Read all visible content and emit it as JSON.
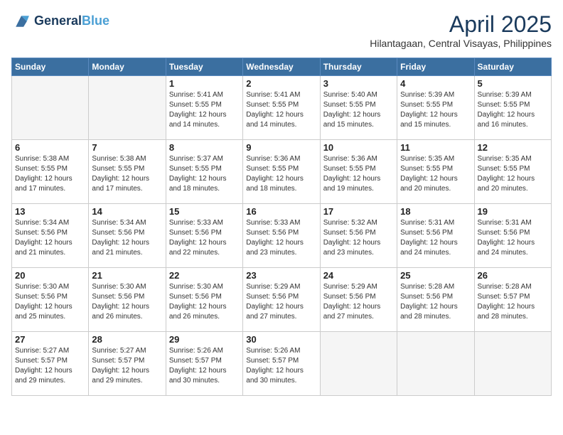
{
  "header": {
    "logo_line1": "General",
    "logo_line2": "Blue",
    "month": "April 2025",
    "location": "Hilantagaan, Central Visayas, Philippines"
  },
  "weekdays": [
    "Sunday",
    "Monday",
    "Tuesday",
    "Wednesday",
    "Thursday",
    "Friday",
    "Saturday"
  ],
  "weeks": [
    [
      {
        "day": "",
        "info": ""
      },
      {
        "day": "",
        "info": ""
      },
      {
        "day": "1",
        "info": "Sunrise: 5:41 AM\nSunset: 5:55 PM\nDaylight: 12 hours and 14 minutes."
      },
      {
        "day": "2",
        "info": "Sunrise: 5:41 AM\nSunset: 5:55 PM\nDaylight: 12 hours and 14 minutes."
      },
      {
        "day": "3",
        "info": "Sunrise: 5:40 AM\nSunset: 5:55 PM\nDaylight: 12 hours and 15 minutes."
      },
      {
        "day": "4",
        "info": "Sunrise: 5:39 AM\nSunset: 5:55 PM\nDaylight: 12 hours and 15 minutes."
      },
      {
        "day": "5",
        "info": "Sunrise: 5:39 AM\nSunset: 5:55 PM\nDaylight: 12 hours and 16 minutes."
      }
    ],
    [
      {
        "day": "6",
        "info": "Sunrise: 5:38 AM\nSunset: 5:55 PM\nDaylight: 12 hours and 17 minutes."
      },
      {
        "day": "7",
        "info": "Sunrise: 5:38 AM\nSunset: 5:55 PM\nDaylight: 12 hours and 17 minutes."
      },
      {
        "day": "8",
        "info": "Sunrise: 5:37 AM\nSunset: 5:55 PM\nDaylight: 12 hours and 18 minutes."
      },
      {
        "day": "9",
        "info": "Sunrise: 5:36 AM\nSunset: 5:55 PM\nDaylight: 12 hours and 18 minutes."
      },
      {
        "day": "10",
        "info": "Sunrise: 5:36 AM\nSunset: 5:55 PM\nDaylight: 12 hours and 19 minutes."
      },
      {
        "day": "11",
        "info": "Sunrise: 5:35 AM\nSunset: 5:55 PM\nDaylight: 12 hours and 20 minutes."
      },
      {
        "day": "12",
        "info": "Sunrise: 5:35 AM\nSunset: 5:55 PM\nDaylight: 12 hours and 20 minutes."
      }
    ],
    [
      {
        "day": "13",
        "info": "Sunrise: 5:34 AM\nSunset: 5:56 PM\nDaylight: 12 hours and 21 minutes."
      },
      {
        "day": "14",
        "info": "Sunrise: 5:34 AM\nSunset: 5:56 PM\nDaylight: 12 hours and 21 minutes."
      },
      {
        "day": "15",
        "info": "Sunrise: 5:33 AM\nSunset: 5:56 PM\nDaylight: 12 hours and 22 minutes."
      },
      {
        "day": "16",
        "info": "Sunrise: 5:33 AM\nSunset: 5:56 PM\nDaylight: 12 hours and 23 minutes."
      },
      {
        "day": "17",
        "info": "Sunrise: 5:32 AM\nSunset: 5:56 PM\nDaylight: 12 hours and 23 minutes."
      },
      {
        "day": "18",
        "info": "Sunrise: 5:31 AM\nSunset: 5:56 PM\nDaylight: 12 hours and 24 minutes."
      },
      {
        "day": "19",
        "info": "Sunrise: 5:31 AM\nSunset: 5:56 PM\nDaylight: 12 hours and 24 minutes."
      }
    ],
    [
      {
        "day": "20",
        "info": "Sunrise: 5:30 AM\nSunset: 5:56 PM\nDaylight: 12 hours and 25 minutes."
      },
      {
        "day": "21",
        "info": "Sunrise: 5:30 AM\nSunset: 5:56 PM\nDaylight: 12 hours and 26 minutes."
      },
      {
        "day": "22",
        "info": "Sunrise: 5:30 AM\nSunset: 5:56 PM\nDaylight: 12 hours and 26 minutes."
      },
      {
        "day": "23",
        "info": "Sunrise: 5:29 AM\nSunset: 5:56 PM\nDaylight: 12 hours and 27 minutes."
      },
      {
        "day": "24",
        "info": "Sunrise: 5:29 AM\nSunset: 5:56 PM\nDaylight: 12 hours and 27 minutes."
      },
      {
        "day": "25",
        "info": "Sunrise: 5:28 AM\nSunset: 5:56 PM\nDaylight: 12 hours and 28 minutes."
      },
      {
        "day": "26",
        "info": "Sunrise: 5:28 AM\nSunset: 5:57 PM\nDaylight: 12 hours and 28 minutes."
      }
    ],
    [
      {
        "day": "27",
        "info": "Sunrise: 5:27 AM\nSunset: 5:57 PM\nDaylight: 12 hours and 29 minutes."
      },
      {
        "day": "28",
        "info": "Sunrise: 5:27 AM\nSunset: 5:57 PM\nDaylight: 12 hours and 29 minutes."
      },
      {
        "day": "29",
        "info": "Sunrise: 5:26 AM\nSunset: 5:57 PM\nDaylight: 12 hours and 30 minutes."
      },
      {
        "day": "30",
        "info": "Sunrise: 5:26 AM\nSunset: 5:57 PM\nDaylight: 12 hours and 30 minutes."
      },
      {
        "day": "",
        "info": ""
      },
      {
        "day": "",
        "info": ""
      },
      {
        "day": "",
        "info": ""
      }
    ]
  ]
}
